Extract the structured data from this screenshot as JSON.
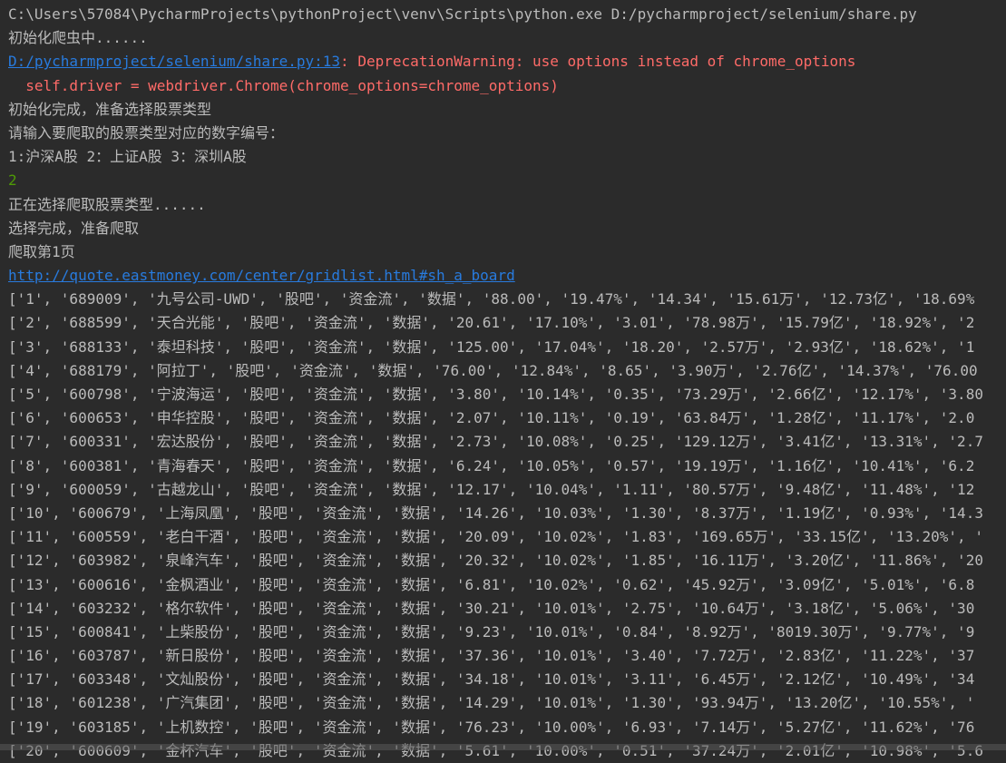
{
  "console": {
    "cmd_line": "C:\\Users\\57084\\PycharmProjects\\pythonProject\\venv\\Scripts\\python.exe D:/pycharmproject/selenium/share.py",
    "init_msg": "初始化爬虫中......",
    "warning_link": "D:/pycharmproject/selenium/share.py:13",
    "warning_text": ": DeprecationWarning: use options instead of chrome_options",
    "warning_code": "  self.driver = webdriver.Chrome(chrome_options=chrome_options)",
    "init_done": "初始化完成，准备选择股票类型",
    "prompt": "请输入要爬取的股票类型对应的数字编号：",
    "options": "1:沪深A股 2：上证A股 3：深圳A股",
    "user_input": "2",
    "selecting": "正在选择爬取股票类型......",
    "selected": "选择完成，准备爬取",
    "page": "爬取第1页",
    "url": "http://quote.eastmoney.com/center/gridlist.html#sh_a_board"
  },
  "rows": [
    "['1', '689009', '九号公司-UWD', '股吧', '资金流', '数据', '88.00', '19.47%', '14.34', '15.61万', '12.73亿', '18.69%",
    "['2', '688599', '天合光能', '股吧', '资金流', '数据', '20.61', '17.10%', '3.01', '78.98万', '15.79亿', '18.92%', '2",
    "['3', '688133', '泰坦科技', '股吧', '资金流', '数据', '125.00', '17.04%', '18.20', '2.57万', '2.93亿', '18.62%', '1",
    "['4', '688179', '阿拉丁', '股吧', '资金流', '数据', '76.00', '12.84%', '8.65', '3.90万', '2.76亿', '14.37%', '76.00",
    "['5', '600798', '宁波海运', '股吧', '资金流', '数据', '3.80', '10.14%', '0.35', '73.29万', '2.66亿', '12.17%', '3.80",
    "['6', '600653', '申华控股', '股吧', '资金流', '数据', '2.07', '10.11%', '0.19', '63.84万', '1.28亿', '11.17%', '2.0",
    "['7', '600331', '宏达股份', '股吧', '资金流', '数据', '2.73', '10.08%', '0.25', '129.12万', '3.41亿', '13.31%', '2.7",
    "['8', '600381', '青海春天', '股吧', '资金流', '数据', '6.24', '10.05%', '0.57', '19.19万', '1.16亿', '10.41%', '6.2",
    "['9', '600059', '古越龙山', '股吧', '资金流', '数据', '12.17', '10.04%', '1.11', '80.57万', '9.48亿', '11.48%', '12",
    "['10', '600679', '上海凤凰', '股吧', '资金流', '数据', '14.26', '10.03%', '1.30', '8.37万', '1.19亿', '0.93%', '14.3",
    "['11', '600559', '老白干酒', '股吧', '资金流', '数据', '20.09', '10.02%', '1.83', '169.65万', '33.15亿', '13.20%', '",
    "['12', '603982', '泉峰汽车', '股吧', '资金流', '数据', '20.32', '10.02%', '1.85', '16.11万', '3.20亿', '11.86%', '20",
    "['13', '600616', '金枫酒业', '股吧', '资金流', '数据', '6.81', '10.02%', '0.62', '45.92万', '3.09亿', '5.01%', '6.8",
    "['14', '603232', '格尔软件', '股吧', '资金流', '数据', '30.21', '10.01%', '2.75', '10.64万', '3.18亿', '5.06%', '30",
    "['15', '600841', '上柴股份', '股吧', '资金流', '数据', '9.23', '10.01%', '0.84', '8.92万', '8019.30万', '9.77%', '9",
    "['16', '603787', '新日股份', '股吧', '资金流', '数据', '37.36', '10.01%', '3.40', '7.72万', '2.83亿', '11.22%', '37",
    "['17', '603348', '文灿股份', '股吧', '资金流', '数据', '34.18', '10.01%', '3.11', '6.45万', '2.12亿', '10.49%', '34",
    "['18', '601238', '广汽集团', '股吧', '资金流', '数据', '14.29', '10.01%', '1.30', '93.94万', '13.20亿', '10.55%', '",
    "['19', '603185', '上机数控', '股吧', '资金流', '数据', '76.23', '10.00%', '6.93', '7.14万', '5.27亿', '11.62%', '76",
    "['20', '600609', '金杯汽车', '股吧', '资金流', '数据', '5.61', '10.00%', '0.51', '37.24万', '2.01亿', '10.98%', '5.6"
  ],
  "colors": {
    "background": "#2b2b2b",
    "text": "#bbbbbb",
    "error": "#ff6b68",
    "link": "#287bde",
    "user_input": "#4e9a06"
  }
}
